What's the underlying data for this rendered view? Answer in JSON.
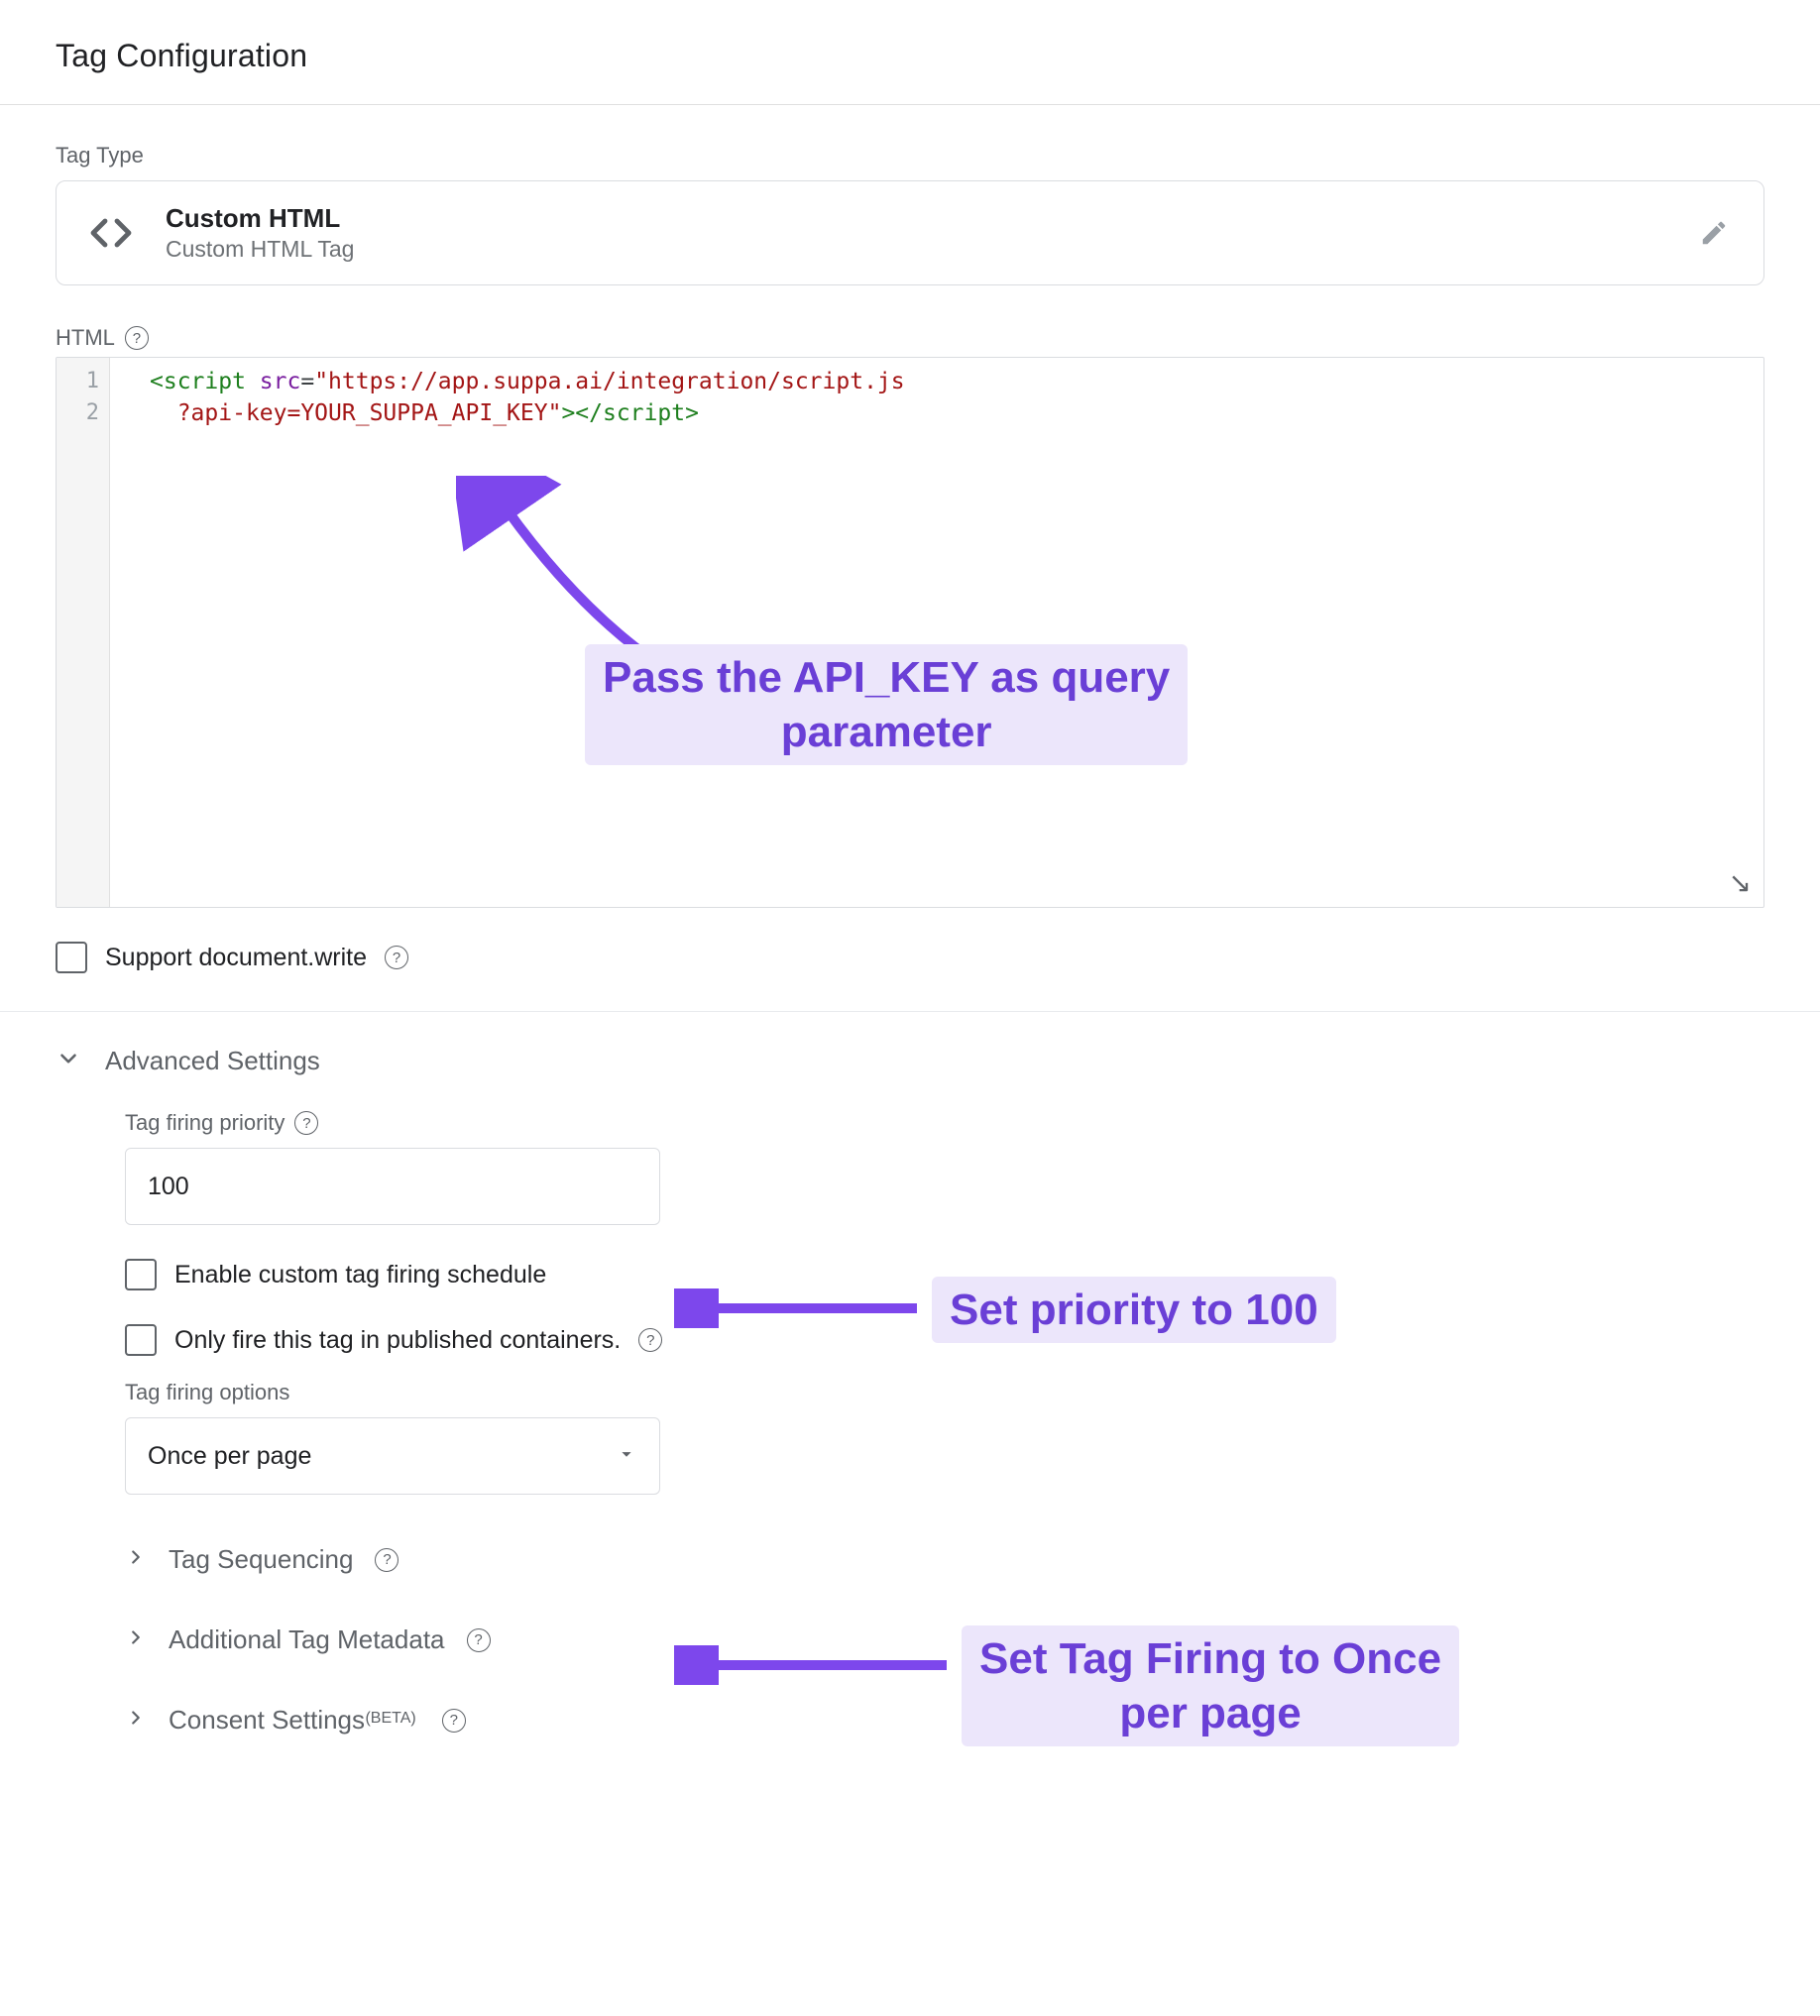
{
  "header": {
    "title": "Tag Configuration"
  },
  "tag_type": {
    "label": "Tag Type",
    "title": "Custom HTML",
    "subtitle": "Custom HTML Tag"
  },
  "html_section": {
    "label": "HTML",
    "line_numbers": [
      "1",
      "2"
    ],
    "code": {
      "l1_text_open": "<script",
      "l1_attr": " src",
      "l1_eq": "=",
      "l1_str_part1": "\"https://app.suppa.ai/integration/script.js",
      "l2_str_part2": "?api-key=YOUR_SUPPA_API_KEY\"",
      "l2_gt": ">",
      "l2_close": "</script>"
    }
  },
  "support_doc_write": {
    "label": "Support document.write"
  },
  "advanced": {
    "title": "Advanced Settings",
    "priority": {
      "label": "Tag firing priority",
      "value": "100"
    },
    "enable_schedule": {
      "label": "Enable custom tag firing schedule"
    },
    "only_published": {
      "label": "Only fire this tag in published containers."
    },
    "firing_options": {
      "label": "Tag firing options",
      "value": "Once per page"
    },
    "subsections": {
      "sequencing": "Tag Sequencing",
      "metadata": "Additional Tag Metadata",
      "consent": "Consent Settings",
      "consent_beta": "(BETA)"
    }
  },
  "annotations": {
    "api_key": "Pass the API_KEY as query\nparameter",
    "priority": "Set priority to 100",
    "firing": "Set Tag Firing to Once\nper page"
  }
}
